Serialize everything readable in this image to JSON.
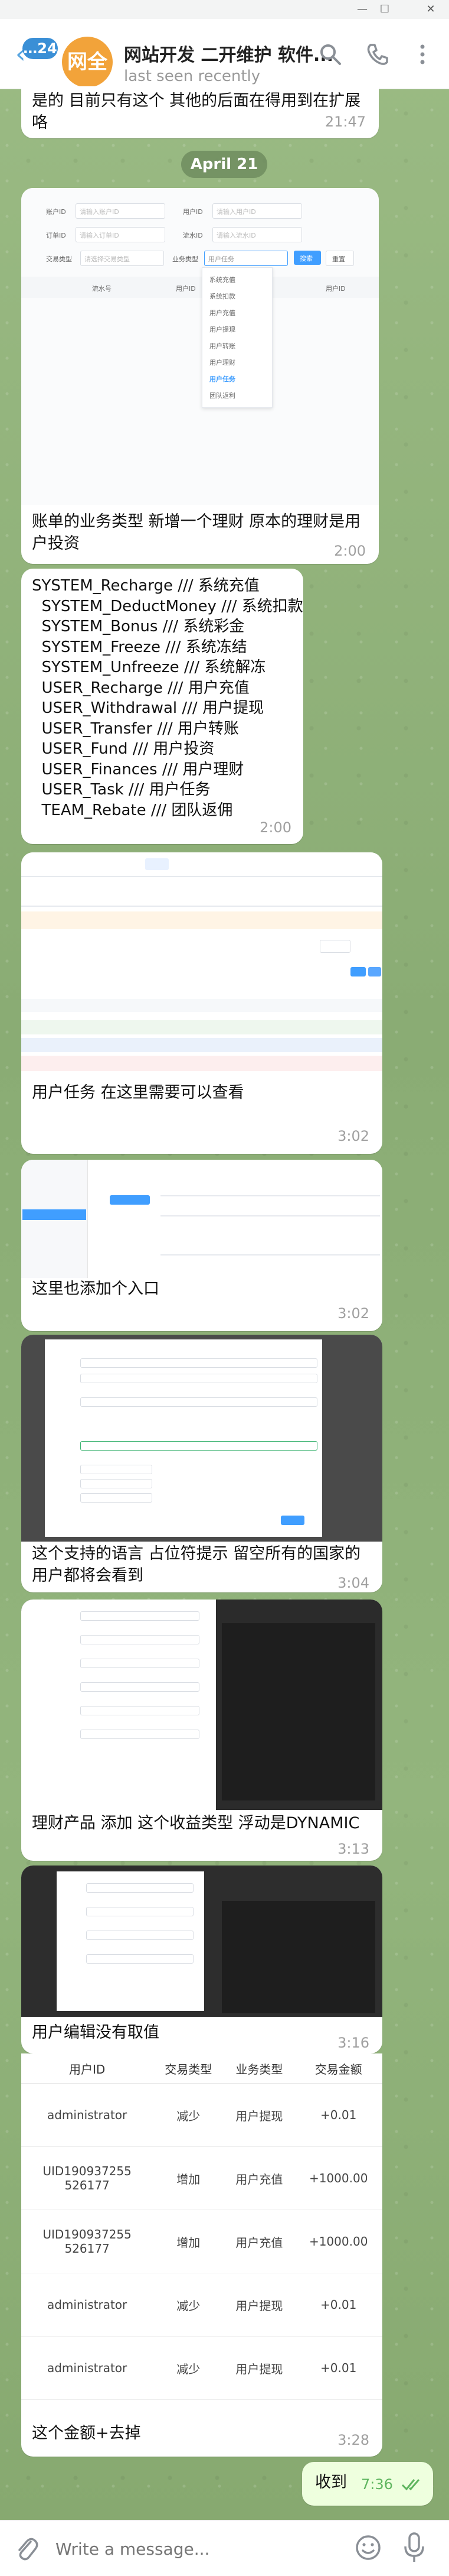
{
  "window": {
    "controls": [
      "—",
      "☐",
      "✕"
    ]
  },
  "header": {
    "unread_badge": "24",
    "avatar_text": "网全",
    "title": "网站开发 二开维护 软件...",
    "status": "last seen recently"
  },
  "date_separator": "April 21",
  "messages": [
    {
      "text": "是的 目前只有这个 其他的后面在得用到在扩展咯",
      "time": "21:47"
    },
    {
      "text": "账单的业务类型 新增一个理财 原本的理财是用户投资",
      "time": "2:00"
    },
    {
      "text": "SYSTEM_Recharge /// 系统充值\n  SYSTEM_DeductMoney /// 系统扣款\n  SYSTEM_Bonus /// 系统彩金\n  SYSTEM_Freeze /// 系统冻结\n  SYSTEM_Unfreeze /// 系统解冻\n  USER_Recharge /// 用户充值\n  USER_Withdrawal /// 用户提现\n  USER_Transfer /// 用户转账\n  USER_Fund /// 用户投资\n  USER_Finances /// 用户理财\n  USER_Task /// 用户任务\n  TEAM_Rebate /// 团队返佣",
      "time": "2:00"
    },
    {
      "text": "用户任务 在这里需要可以查看",
      "time": "3:02"
    },
    {
      "text": "这里也添加个入口",
      "time": "3:02"
    },
    {
      "text": "这个支持的语言 占位符提示 留空所有的国家的用户都将会看到",
      "time": "3:04"
    },
    {
      "text": "理财产品 添加 这个收益类型 浮动是DYNAMIC",
      "time": "3:13"
    },
    {
      "text": "用户编辑没有取值",
      "time": "3:16"
    },
    {
      "text": "这个金额+去掉",
      "time": "3:28"
    }
  ],
  "outgoing": {
    "text": "收到",
    "time": "7:36"
  },
  "shot1": {
    "filters": [
      "账户ID",
      "请输入账户ID",
      "用户ID",
      "请输入用户ID",
      "订单ID",
      "请输入订单ID",
      "流水ID",
      "请输入流水ID",
      "交易类型",
      "请选择交易类型",
      "业务类型",
      "用户任务",
      "搜索",
      "重置"
    ],
    "columns": [
      "流水号",
      "用户ID",
      "用户ID"
    ],
    "dropdown": [
      "系统充值",
      "系统扣款",
      "用户充值",
      "用户提现",
      "用户转账",
      "用户理财",
      "用户任务",
      "团队返利"
    ]
  },
  "table_shot": {
    "columns": [
      "用户ID",
      "交易类型",
      "业务类型",
      "交易金额"
    ],
    "rows": [
      [
        "administrator",
        "减少",
        "用户提现",
        "+0.01"
      ],
      [
        "UID190937255\n526177",
        "增加",
        "用户充值",
        "+1000.00"
      ],
      [
        "UID190937255\n526177",
        "增加",
        "用户充值",
        "+1000.00"
      ],
      [
        "administrator",
        "减少",
        "用户提现",
        "+0.01"
      ],
      [
        "administrator",
        "减少",
        "用户提现",
        "+0.01"
      ]
    ]
  },
  "composer": {
    "placeholder": "Write a message..."
  },
  "colors": {
    "accent": "#3a8fd6",
    "avatar": "#f2a33a",
    "outgoing_bg": "#eeffde",
    "time_green": "#5fb55f"
  }
}
